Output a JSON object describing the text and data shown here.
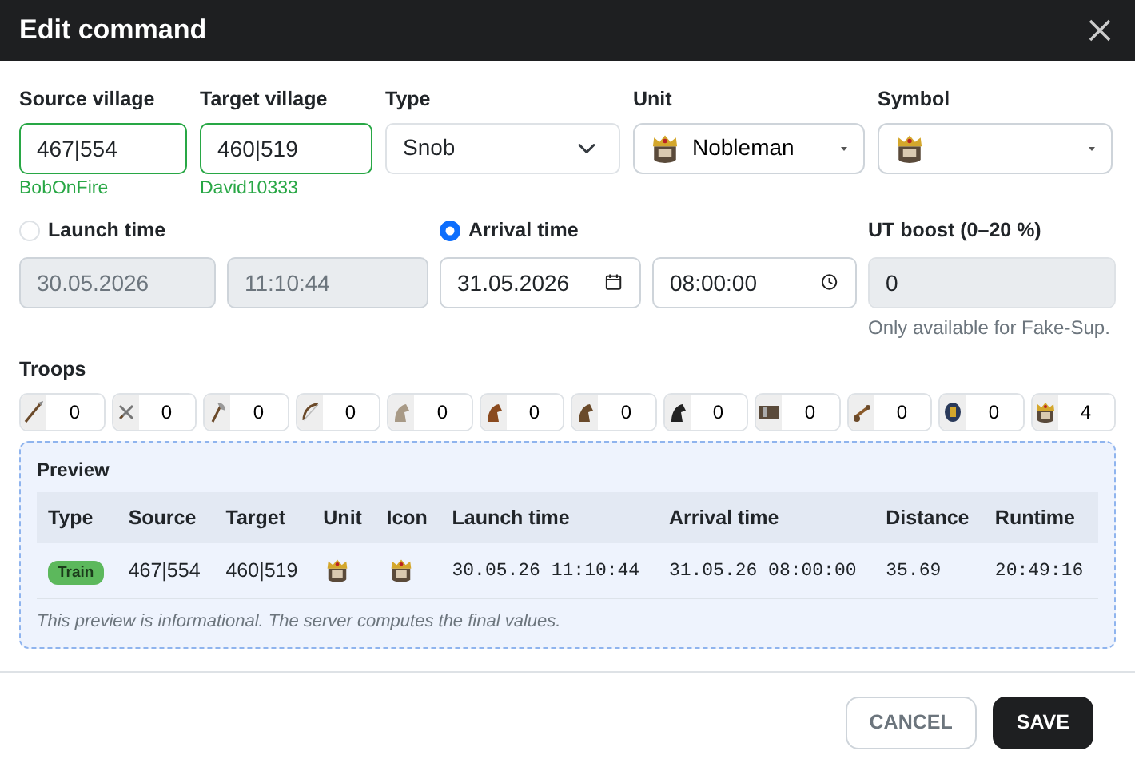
{
  "modal": {
    "title": "Edit command"
  },
  "top_fields": [
    {
      "kind": "village",
      "label": "Source village",
      "value": "467|554",
      "valid": true,
      "note": "BobOnFire"
    },
    {
      "kind": "village",
      "label": "Target village",
      "value": "460|519",
      "valid": true,
      "note": "David10333"
    },
    {
      "kind": "select",
      "label": "Type",
      "value": "Snob"
    },
    {
      "kind": "unit",
      "label": "Unit",
      "value": "Nobleman"
    },
    {
      "kind": "symbol",
      "label": "Symbol"
    }
  ],
  "timing": [
    {
      "label": "Launch time",
      "selected": false,
      "date": "30.05.2026",
      "time": "11:10:44"
    },
    {
      "label": "Arrival time",
      "selected": true,
      "date": "31.05.2026",
      "time": "08:00:00"
    }
  ],
  "ut_boost": {
    "label": "UT boost (0–20 %)",
    "value": "0",
    "disabled": true,
    "help": "Only available for Fake-Sup."
  },
  "troops": {
    "label": "Troops",
    "items": [
      {
        "count": "0"
      },
      {
        "count": "0"
      },
      {
        "count": "0"
      },
      {
        "count": "0"
      },
      {
        "count": "0"
      },
      {
        "count": "0"
      },
      {
        "count": "0"
      },
      {
        "count": "0"
      },
      {
        "count": "0"
      },
      {
        "count": "0"
      },
      {
        "count": "0"
      },
      {
        "count": "4"
      }
    ]
  },
  "preview": {
    "title": "Preview",
    "columns": [
      "Type",
      "Source",
      "Target",
      "Unit",
      "Icon",
      "Launch time",
      "Arrival time",
      "Distance",
      "Runtime"
    ],
    "rows": [
      {
        "type": "Train",
        "source": "467|554",
        "target": "460|519",
        "launch": "30.05.26 11:10:44",
        "arrival": "31.05.26 08:00:00",
        "distance": "35.69",
        "runtime": "20:49:16"
      }
    ],
    "note": "This preview is informational. The server computes the final values."
  },
  "buttons": [
    {
      "label": "CANCEL",
      "kind": "secondary"
    },
    {
      "label": "SAVE",
      "kind": "primary"
    }
  ]
}
